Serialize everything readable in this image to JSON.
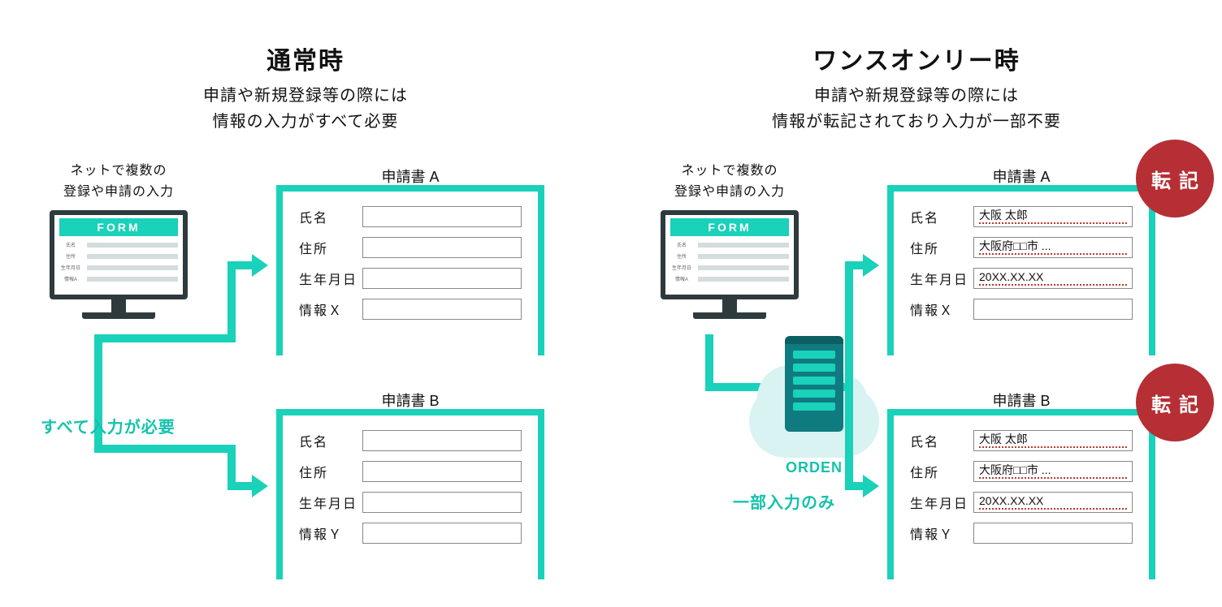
{
  "colors": {
    "teal": "#1ad1b9",
    "tealText": "#14c2ac",
    "red": "#b52f35",
    "underline": "#c0392b"
  },
  "left": {
    "heading": "通常時",
    "sub_line1": "申請や新規登録等の際には",
    "sub_line2": "情報の入力がすべて必要",
    "monitor_caption_l1": "ネットで複数の",
    "monitor_caption_l2": "登録や申請の入力",
    "monitor_banner": "FORM",
    "monitor_labels": [
      "氏名",
      "住所",
      "生年月日",
      "情報A"
    ],
    "emphasis": "すべて入力が必要",
    "form_a": {
      "title": "申請書 A",
      "rows": [
        {
          "label": "氏名",
          "value": ""
        },
        {
          "label": "住所",
          "value": ""
        },
        {
          "label": "生年月日",
          "value": ""
        },
        {
          "label": "情報Ｘ",
          "value": ""
        }
      ]
    },
    "form_b": {
      "title": "申請書 B",
      "rows": [
        {
          "label": "氏名",
          "value": ""
        },
        {
          "label": "住所",
          "value": ""
        },
        {
          "label": "生年月日",
          "value": ""
        },
        {
          "label": "情報Ｙ",
          "value": ""
        }
      ]
    }
  },
  "right": {
    "heading": "ワンスオンリー時",
    "sub_line1": "申請や新規登録等の際には",
    "sub_line2": "情報が転記されており入力が一部不要",
    "monitor_caption_l1": "ネットで複数の",
    "monitor_caption_l2": "登録や申請の入力",
    "monitor_banner": "FORM",
    "monitor_labels": [
      "氏名",
      "住所",
      "生年月日",
      "情報A"
    ],
    "server_label": "ORDEN",
    "emphasis": "一部入力のみ",
    "badge_text": "転記",
    "form_a": {
      "title": "申請書 A",
      "rows": [
        {
          "label": "氏名",
          "value": "大阪 太郎",
          "prefilled": true
        },
        {
          "label": "住所",
          "value": "大阪府□□市 ...",
          "prefilled": true
        },
        {
          "label": "生年月日",
          "value": "20XX.XX.XX",
          "prefilled": true
        },
        {
          "label": "情報Ｘ",
          "value": "",
          "prefilled": false
        }
      ]
    },
    "form_b": {
      "title": "申請書 B",
      "rows": [
        {
          "label": "氏名",
          "value": "大阪 太郎",
          "prefilled": true
        },
        {
          "label": "住所",
          "value": "大阪府□□市 ...",
          "prefilled": true
        },
        {
          "label": "生年月日",
          "value": "20XX.XX.XX",
          "prefilled": true
        },
        {
          "label": "情報Ｙ",
          "value": "",
          "prefilled": false
        }
      ]
    }
  }
}
